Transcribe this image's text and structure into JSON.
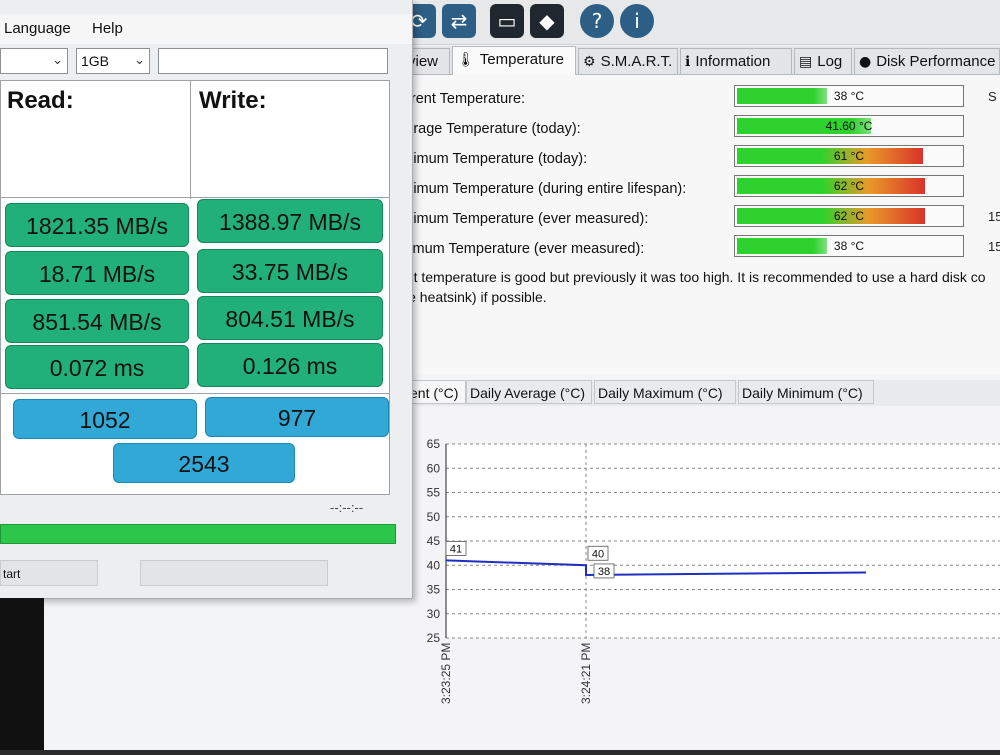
{
  "toolbar": {
    "icons": [
      "refresh-disk-icon",
      "network-icon",
      "monitor-icon",
      "alert-icon",
      "help-icon",
      "info-icon"
    ],
    "glyphs": [
      "⟳",
      "⇄",
      "▭",
      "◆",
      "?",
      "i"
    ]
  },
  "tabs": [
    {
      "label": "rview",
      "icon": "overview-icon",
      "glyph": ""
    },
    {
      "label": "Temperature",
      "icon": "thermometer-icon",
      "glyph": "🌡"
    },
    {
      "label": "S.M.A.R.T.",
      "icon": "smart-icon",
      "glyph": "⚙"
    },
    {
      "label": "Information",
      "icon": "info-icon",
      "glyph": "ℹ"
    },
    {
      "label": "Log",
      "icon": "log-icon",
      "glyph": "▤"
    },
    {
      "label": "Disk Performance",
      "icon": "performance-icon",
      "glyph": "●"
    }
  ],
  "temperature": {
    "rows": [
      {
        "label": "urrent Temperature:",
        "value": "38 °C",
        "fill_fraction": 0.4,
        "side": "S"
      },
      {
        "label": "verage Temperature (today):",
        "value": "41.60 °C",
        "fill_fraction": 0.6,
        "side": ""
      },
      {
        "label": "aximum Temperature (today):",
        "value": "61 °C",
        "fill_fraction": 0.83,
        "side": ""
      },
      {
        "label": "aximum Temperature (during entire lifespan):",
        "value": "62 °C",
        "fill_fraction": 0.84,
        "side": ""
      },
      {
        "label": "aximum Temperature (ever measured):",
        "value": "62 °C",
        "fill_fraction": 0.84,
        "side": "15"
      },
      {
        "label": "inimum Temperature (ever measured):",
        "value": "38 °C",
        "fill_fraction": 0.4,
        "side": "15"
      }
    ],
    "message_line1": "ent temperature is good but previously it was too high. It is recommended to use a hard disk co",
    "message_line2": "ive heatsink) if possible.",
    "colors": {
      "cool": "#2fd12f",
      "warm": "#e89a2a",
      "hot": "#d8332a"
    }
  },
  "graph_tabs": [
    "ent (°C)",
    "Daily Average (°C)",
    "Daily Maximum (°C)",
    "Daily Minimum (°C)"
  ],
  "chart_data": {
    "type": "line",
    "y_ticks": [
      65,
      60,
      55,
      50,
      45,
      40,
      35,
      30,
      25
    ],
    "ylim": [
      25,
      65
    ],
    "x_labels": [
      "3:23:25 PM",
      "3:24:21 PM"
    ],
    "series": [
      {
        "points": [
          [
            0,
            41
          ],
          [
            1,
            40
          ],
          [
            1,
            38
          ],
          [
            3,
            38.5
          ]
        ],
        "point_labels": [
          "41",
          "40",
          "38"
        ]
      }
    ],
    "color": "#1f2fc2"
  },
  "bench": {
    "menu": [
      "Language",
      "Help"
    ],
    "select1": "",
    "select2": "1GB",
    "input_value": "",
    "read_header": "Read:",
    "write_header": "Write:",
    "results": [
      {
        "read": "1821.35 MB/s",
        "write": "1388.97 MB/s"
      },
      {
        "read": "18.71 MB/s",
        "write": "33.75 MB/s"
      },
      {
        "read": "851.54 MB/s",
        "write": "804.51 MB/s"
      },
      {
        "read": "0.072 ms",
        "write": "0.126 ms"
      }
    ],
    "score_read": "1052",
    "score_write": "977",
    "score_total": "2543",
    "status": "--:--:--",
    "progress_fraction": 1.0,
    "start_label": "tart",
    "colors": {
      "cell": "#22b07a",
      "score": "#31a8d6",
      "progress": "#2cc64a"
    }
  }
}
